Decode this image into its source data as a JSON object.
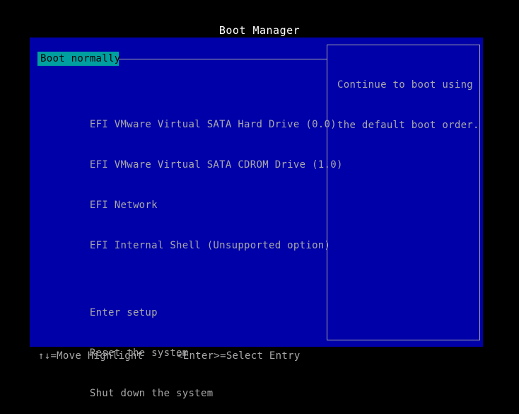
{
  "title": "Boot Manager",
  "colors": {
    "background": "#000000",
    "panel": "#0000a8",
    "text": "#a8a8a8",
    "title_text": "#ffffff",
    "highlight_bg": "#00a0a0",
    "highlight_text": "#000000",
    "border": "#a8a8a8"
  },
  "menu": {
    "selected": {
      "label": "Boot normally"
    },
    "boot_devices": [
      {
        "label": "EFI VMware Virtual SATA Hard Drive (0.0)"
      },
      {
        "label": "EFI VMware Virtual SATA CDROM Drive (1.0)"
      },
      {
        "label": "EFI Network"
      },
      {
        "label": "EFI Internal Shell (Unsupported option)"
      }
    ],
    "system_actions": [
      {
        "label": "Enter setup"
      },
      {
        "label": "Reset the system"
      },
      {
        "label": "Shut down the system"
      }
    ]
  },
  "help": {
    "line1": "Continue to boot using",
    "line2": "the default boot order."
  },
  "statusbar": {
    "move_hint": "↑↓=Move Highlight",
    "select_hint": "<Enter>=Select Entry"
  }
}
